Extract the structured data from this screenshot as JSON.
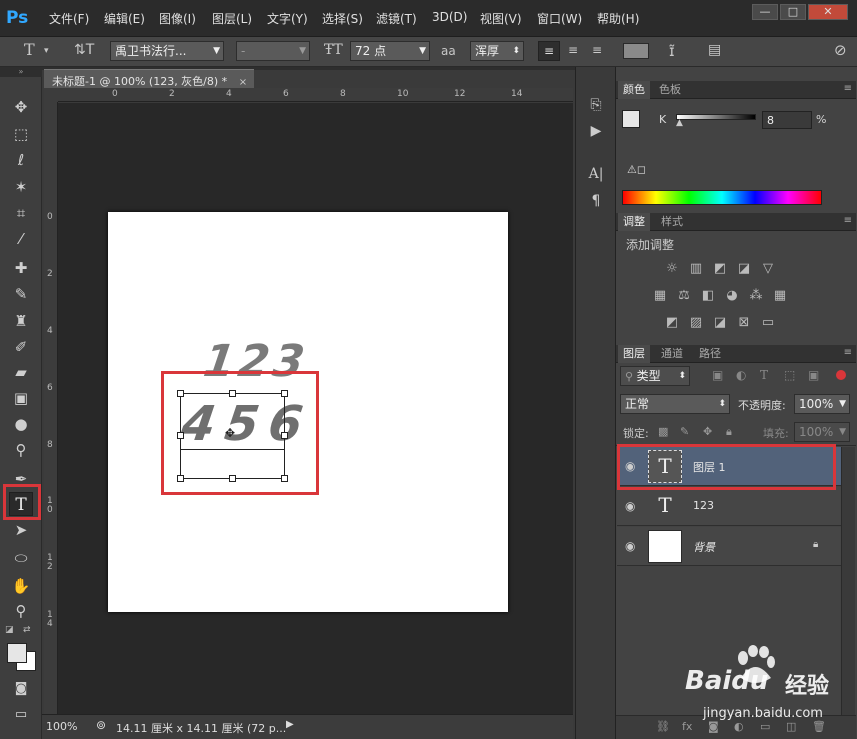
{
  "app": {
    "logo": "Ps"
  },
  "menu": [
    "文件(F)",
    "编辑(E)",
    "图像(I)",
    "图层(L)",
    "文字(Y)",
    "选择(S)",
    "滤镜(T)",
    "3D(D)",
    "视图(V)",
    "窗口(W)",
    "帮助(H)"
  ],
  "window_controls": [
    "—",
    "□",
    "✕"
  ],
  "options": {
    "font_family": "禹卫书法行...",
    "font_style": "-",
    "font_size": "72 点",
    "antialias": "浑厚",
    "aa_label": "aa"
  },
  "document": {
    "tab_title": "未标题-1 @ 100% (123, 灰色/8) *",
    "canvas_text_top": "123",
    "canvas_text_bottom": "456"
  },
  "ruler_h": [
    "0",
    "2",
    "4",
    "6",
    "8",
    "10",
    "12",
    "14"
  ],
  "ruler_v": [
    "0",
    "2",
    "4",
    "6",
    "8",
    "1\n0",
    "1\n2",
    "1\n4"
  ],
  "status": {
    "zoom": "100%",
    "doc_info": "14.11 厘米 x 14.11 厘米 (72 p..."
  },
  "color_panel": {
    "tabs": [
      "颜色",
      "色板"
    ],
    "channel": "K",
    "value": "8",
    "unit": "%"
  },
  "adjust_panel": {
    "tabs": [
      "调整",
      "样式"
    ],
    "title": "添加调整"
  },
  "layers_panel": {
    "tabs": [
      "图层",
      "通道",
      "路径"
    ],
    "filter": "类型",
    "blend_mode": "正常",
    "opacity_label": "不透明度:",
    "opacity": "100%",
    "lock_label": "锁定:",
    "fill_label": "填充:",
    "fill": "100%",
    "layers": [
      {
        "name": "图层 1"
      },
      {
        "name": "123"
      },
      {
        "name": "背景"
      }
    ]
  },
  "watermark": {
    "brand": "Baidu",
    "cn": "经验",
    "url": "jingyan.baidu.com"
  },
  "colors": {
    "highlight": "#d9363a",
    "selected_layer": "#52627a"
  }
}
